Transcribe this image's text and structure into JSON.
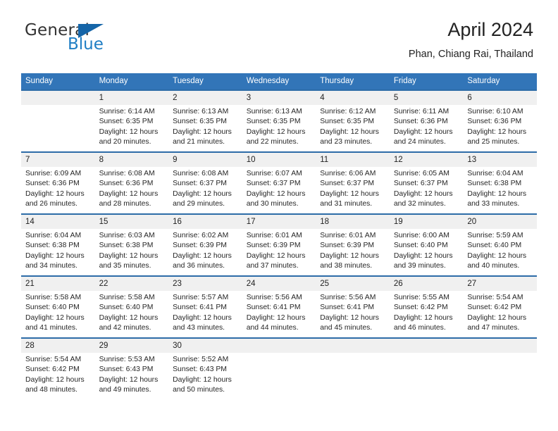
{
  "brand": {
    "name_part1": "General",
    "name_part2": "Blue"
  },
  "header": {
    "title": "April 2024",
    "location": "Phan, Chiang Rai, Thailand"
  },
  "calendar": {
    "weekday_headers": [
      "Sunday",
      "Monday",
      "Tuesday",
      "Wednesday",
      "Thursday",
      "Friday",
      "Saturday"
    ],
    "colors": {
      "header_band": "#3275b8",
      "row_divider": "#2d6ca8",
      "daynum_background": "#f0f0f0",
      "brand_blue": "#1f7ec4",
      "brand_dark_blue": "#1565a8"
    },
    "weeks": [
      [
        {
          "day": "",
          "lines": []
        },
        {
          "day": "1",
          "lines": [
            "Sunrise: 6:14 AM",
            "Sunset: 6:35 PM",
            "Daylight: 12 hours",
            "and 20 minutes."
          ]
        },
        {
          "day": "2",
          "lines": [
            "Sunrise: 6:13 AM",
            "Sunset: 6:35 PM",
            "Daylight: 12 hours",
            "and 21 minutes."
          ]
        },
        {
          "day": "3",
          "lines": [
            "Sunrise: 6:13 AM",
            "Sunset: 6:35 PM",
            "Daylight: 12 hours",
            "and 22 minutes."
          ]
        },
        {
          "day": "4",
          "lines": [
            "Sunrise: 6:12 AM",
            "Sunset: 6:35 PM",
            "Daylight: 12 hours",
            "and 23 minutes."
          ]
        },
        {
          "day": "5",
          "lines": [
            "Sunrise: 6:11 AM",
            "Sunset: 6:36 PM",
            "Daylight: 12 hours",
            "and 24 minutes."
          ]
        },
        {
          "day": "6",
          "lines": [
            "Sunrise: 6:10 AM",
            "Sunset: 6:36 PM",
            "Daylight: 12 hours",
            "and 25 minutes."
          ]
        }
      ],
      [
        {
          "day": "7",
          "lines": [
            "Sunrise: 6:09 AM",
            "Sunset: 6:36 PM",
            "Daylight: 12 hours",
            "and 26 minutes."
          ]
        },
        {
          "day": "8",
          "lines": [
            "Sunrise: 6:08 AM",
            "Sunset: 6:36 PM",
            "Daylight: 12 hours",
            "and 28 minutes."
          ]
        },
        {
          "day": "9",
          "lines": [
            "Sunrise: 6:08 AM",
            "Sunset: 6:37 PM",
            "Daylight: 12 hours",
            "and 29 minutes."
          ]
        },
        {
          "day": "10",
          "lines": [
            "Sunrise: 6:07 AM",
            "Sunset: 6:37 PM",
            "Daylight: 12 hours",
            "and 30 minutes."
          ]
        },
        {
          "day": "11",
          "lines": [
            "Sunrise: 6:06 AM",
            "Sunset: 6:37 PM",
            "Daylight: 12 hours",
            "and 31 minutes."
          ]
        },
        {
          "day": "12",
          "lines": [
            "Sunrise: 6:05 AM",
            "Sunset: 6:37 PM",
            "Daylight: 12 hours",
            "and 32 minutes."
          ]
        },
        {
          "day": "13",
          "lines": [
            "Sunrise: 6:04 AM",
            "Sunset: 6:38 PM",
            "Daylight: 12 hours",
            "and 33 minutes."
          ]
        }
      ],
      [
        {
          "day": "14",
          "lines": [
            "Sunrise: 6:04 AM",
            "Sunset: 6:38 PM",
            "Daylight: 12 hours",
            "and 34 minutes."
          ]
        },
        {
          "day": "15",
          "lines": [
            "Sunrise: 6:03 AM",
            "Sunset: 6:38 PM",
            "Daylight: 12 hours",
            "and 35 minutes."
          ]
        },
        {
          "day": "16",
          "lines": [
            "Sunrise: 6:02 AM",
            "Sunset: 6:39 PM",
            "Daylight: 12 hours",
            "and 36 minutes."
          ]
        },
        {
          "day": "17",
          "lines": [
            "Sunrise: 6:01 AM",
            "Sunset: 6:39 PM",
            "Daylight: 12 hours",
            "and 37 minutes."
          ]
        },
        {
          "day": "18",
          "lines": [
            "Sunrise: 6:01 AM",
            "Sunset: 6:39 PM",
            "Daylight: 12 hours",
            "and 38 minutes."
          ]
        },
        {
          "day": "19",
          "lines": [
            "Sunrise: 6:00 AM",
            "Sunset: 6:40 PM",
            "Daylight: 12 hours",
            "and 39 minutes."
          ]
        },
        {
          "day": "20",
          "lines": [
            "Sunrise: 5:59 AM",
            "Sunset: 6:40 PM",
            "Daylight: 12 hours",
            "and 40 minutes."
          ]
        }
      ],
      [
        {
          "day": "21",
          "lines": [
            "Sunrise: 5:58 AM",
            "Sunset: 6:40 PM",
            "Daylight: 12 hours",
            "and 41 minutes."
          ]
        },
        {
          "day": "22",
          "lines": [
            "Sunrise: 5:58 AM",
            "Sunset: 6:40 PM",
            "Daylight: 12 hours",
            "and 42 minutes."
          ]
        },
        {
          "day": "23",
          "lines": [
            "Sunrise: 5:57 AM",
            "Sunset: 6:41 PM",
            "Daylight: 12 hours",
            "and 43 minutes."
          ]
        },
        {
          "day": "24",
          "lines": [
            "Sunrise: 5:56 AM",
            "Sunset: 6:41 PM",
            "Daylight: 12 hours",
            "and 44 minutes."
          ]
        },
        {
          "day": "25",
          "lines": [
            "Sunrise: 5:56 AM",
            "Sunset: 6:41 PM",
            "Daylight: 12 hours",
            "and 45 minutes."
          ]
        },
        {
          "day": "26",
          "lines": [
            "Sunrise: 5:55 AM",
            "Sunset: 6:42 PM",
            "Daylight: 12 hours",
            "and 46 minutes."
          ]
        },
        {
          "day": "27",
          "lines": [
            "Sunrise: 5:54 AM",
            "Sunset: 6:42 PM",
            "Daylight: 12 hours",
            "and 47 minutes."
          ]
        }
      ],
      [
        {
          "day": "28",
          "lines": [
            "Sunrise: 5:54 AM",
            "Sunset: 6:42 PM",
            "Daylight: 12 hours",
            "and 48 minutes."
          ]
        },
        {
          "day": "29",
          "lines": [
            "Sunrise: 5:53 AM",
            "Sunset: 6:43 PM",
            "Daylight: 12 hours",
            "and 49 minutes."
          ]
        },
        {
          "day": "30",
          "lines": [
            "Sunrise: 5:52 AM",
            "Sunset: 6:43 PM",
            "Daylight: 12 hours",
            "and 50 minutes."
          ]
        },
        {
          "day": "",
          "lines": []
        },
        {
          "day": "",
          "lines": []
        },
        {
          "day": "",
          "lines": []
        },
        {
          "day": "",
          "lines": []
        }
      ]
    ]
  }
}
